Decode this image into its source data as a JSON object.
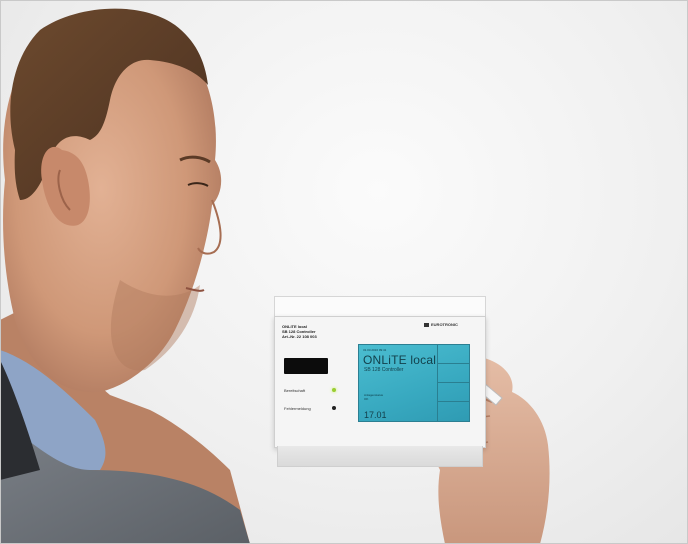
{
  "device": {
    "label_lines": [
      "ONLiTE local",
      "SB 128 Controller",
      "Art.-Nr. 22 108 003"
    ],
    "brand": "EUROTRONIC",
    "led_labels": [
      "Bereitschaft",
      "Fehlermeldung"
    ],
    "screen": {
      "status": "31.03.2016   09:41",
      "title": "ONLiTE local",
      "subtitle": "SB 128 Controller",
      "info": [
        "Anlagenstatus",
        "OK"
      ],
      "value": "17.01"
    }
  },
  "colors": {
    "wall": "#f1f1f1",
    "screen": "#3aaec3",
    "led_ready": "#9acd32",
    "jacket": "#6f747a",
    "shirt": "#8ea4c6"
  }
}
